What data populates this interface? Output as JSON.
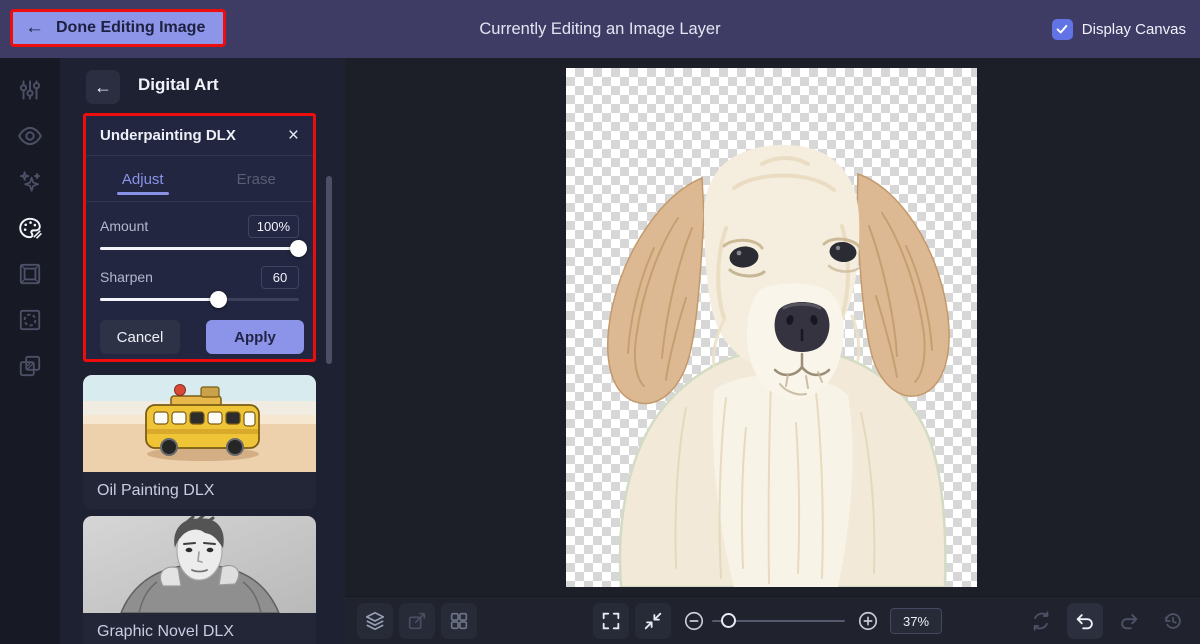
{
  "topbar": {
    "done_button": "Done Editing Image",
    "title": "Currently Editing an Image Layer",
    "display_canvas_label": "Display Canvas",
    "display_canvas_checked": true
  },
  "icons": {
    "back_arrow": "←",
    "close": "×",
    "rail": [
      "adjust-sliders-icon",
      "eye-icon",
      "sparkles-icon",
      "palette-icon",
      "frame-icon",
      "texture-icon",
      "overlays-icon"
    ],
    "toolbar_left": [
      "layers-icon",
      "transform-icon",
      "grid-view-icon"
    ],
    "toolbar_center": [
      "fullscreen-icon",
      "fit-screen-icon",
      "zoom-out-icon",
      "zoom-in-icon"
    ],
    "toolbar_right": [
      "sync-icon",
      "undo-icon",
      "redo-icon",
      "history-icon"
    ]
  },
  "panel": {
    "header": "Digital Art",
    "popup": {
      "title": "Underpainting DLX",
      "tabs": [
        {
          "label": "Adjust",
          "active": true
        },
        {
          "label": "Erase",
          "active": false
        }
      ],
      "controls": [
        {
          "label": "Amount",
          "value": "100%",
          "percent": 100
        },
        {
          "label": "Sharpen",
          "value": "60",
          "percent": 60
        }
      ],
      "cancel_label": "Cancel",
      "apply_label": "Apply"
    },
    "effects": [
      {
        "label": "Oil Painting DLX",
        "thumb": "yellow-bus-oil-painting"
      },
      {
        "label": "Graphic Novel DLX",
        "thumb": "black-white-man-portrait"
      }
    ]
  },
  "toolbar": {
    "zoom_value": "37%",
    "zoom_slider_percent": 12
  },
  "colors": {
    "accent_periwinkle": "#8c94ea",
    "top_bar": "#3e3c64",
    "highlight_red": "#ee0d0d",
    "panel_bg": "#1e2132",
    "workspace_bg": "#1c1e28",
    "active_tab": "#8a92e8"
  }
}
